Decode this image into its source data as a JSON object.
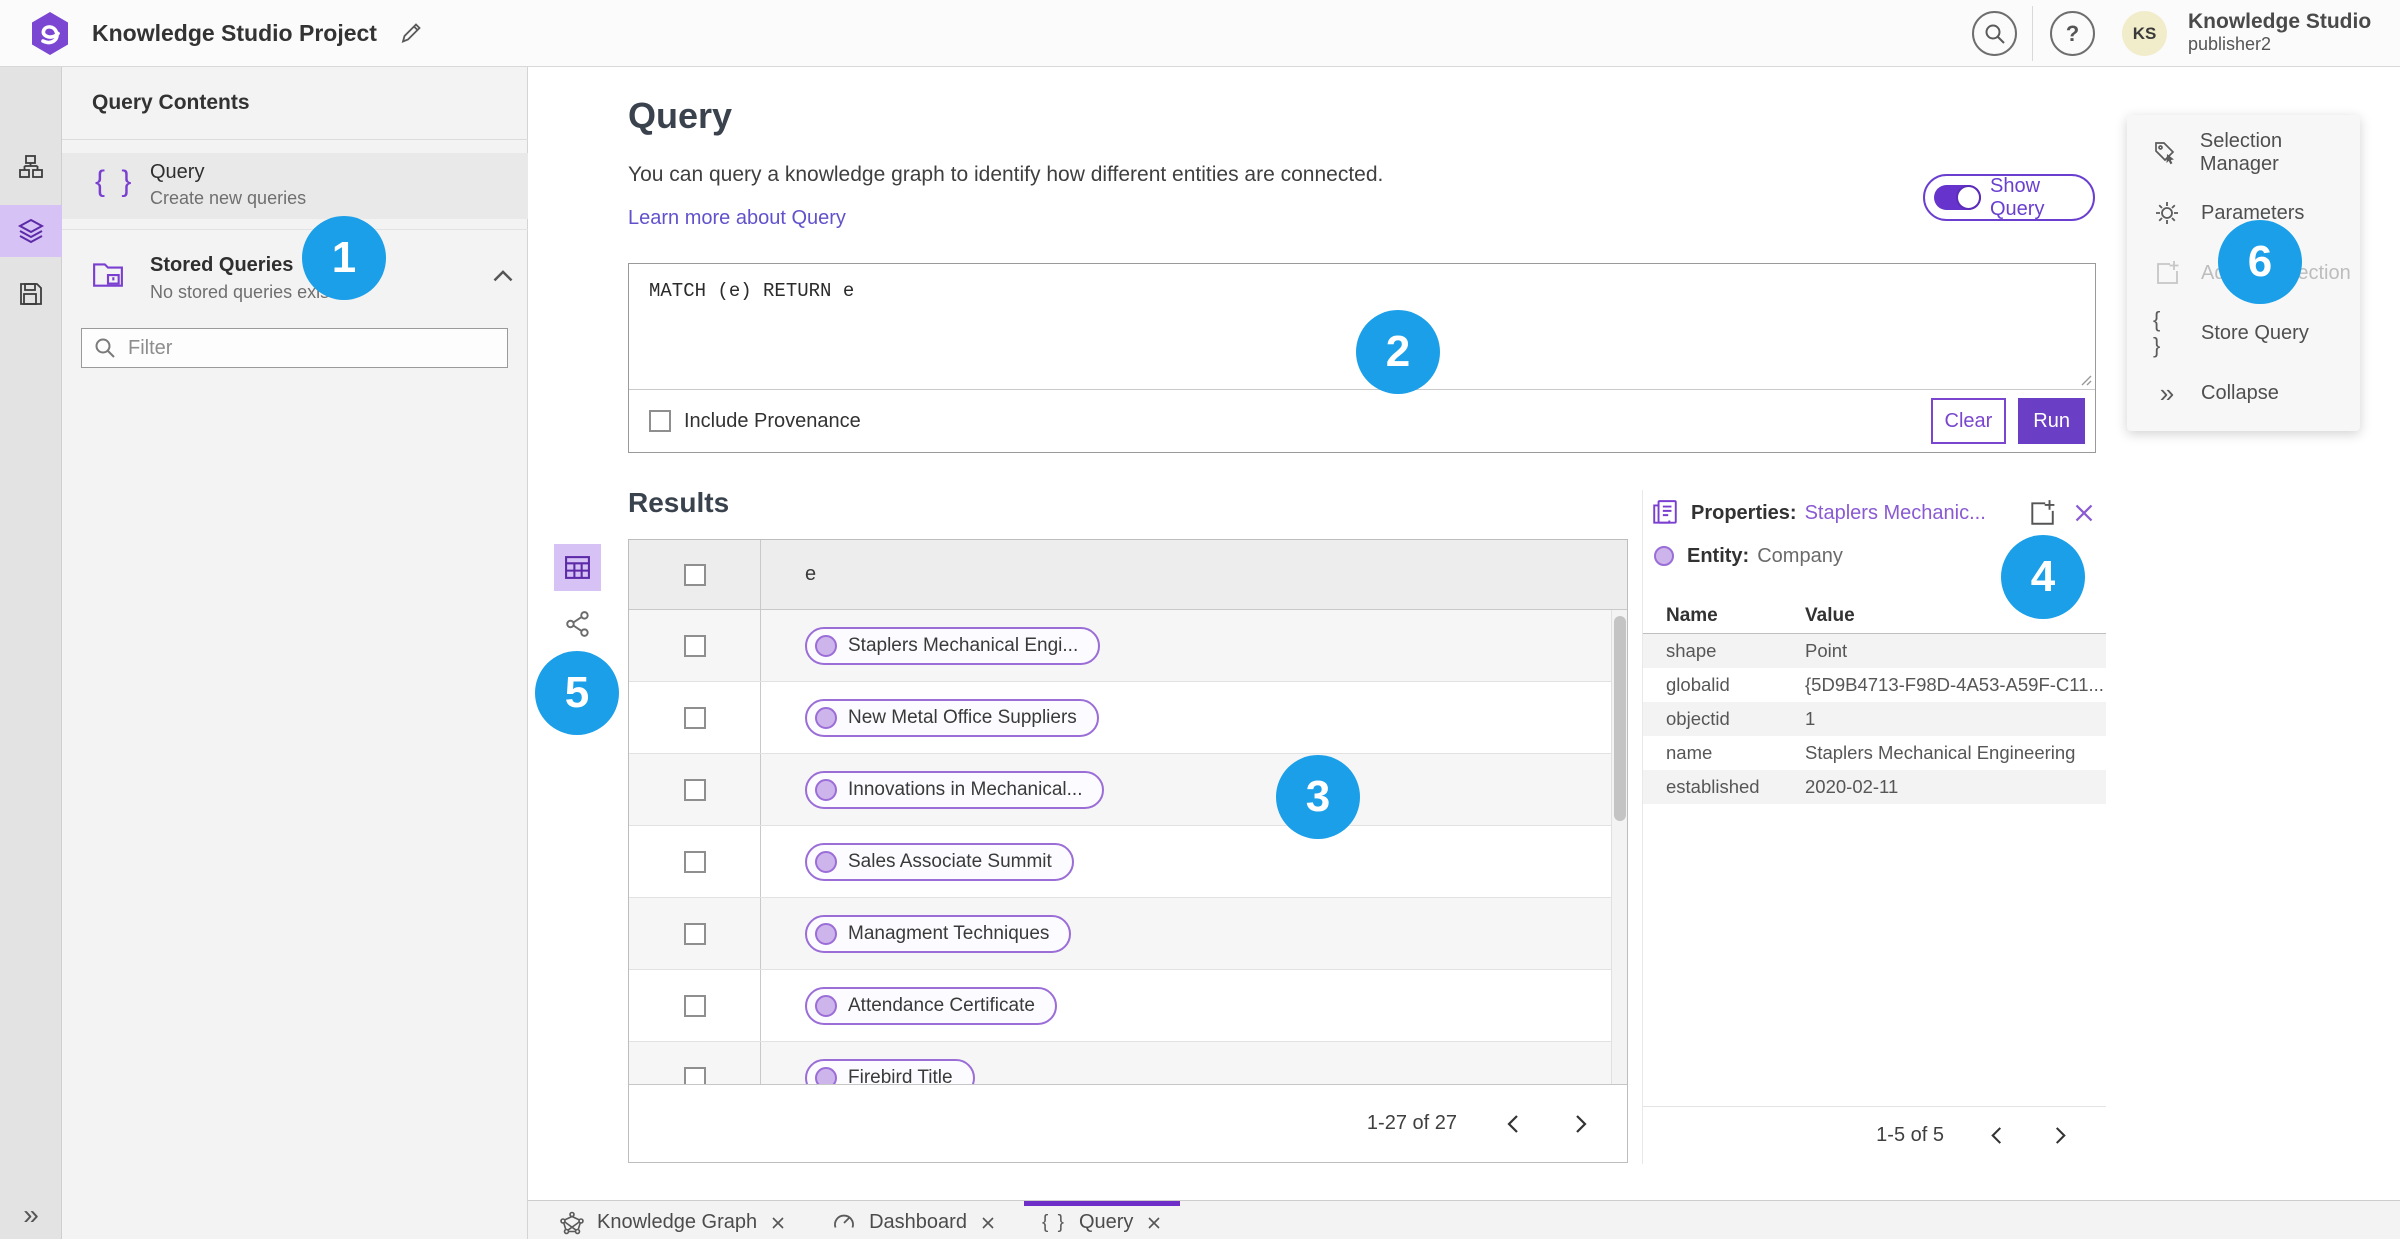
{
  "topbar": {
    "title": "Knowledge Studio Project",
    "user": {
      "initials": "KS",
      "name": "Knowledge Studio",
      "role": "publisher2"
    }
  },
  "glyphs": {
    "braces": "{ }",
    "collapse_chevrons": "»",
    "question_mark": "?"
  },
  "contents_panel": {
    "header": "Query Contents",
    "query_item": {
      "title": "Query",
      "subtitle": "Create new queries"
    },
    "stored_item": {
      "title": "Stored Queries",
      "subtitle": "No stored queries exist"
    },
    "filter_placeholder": "Filter"
  },
  "query_section": {
    "heading": "Query",
    "description": "You can query a knowledge graph to identify how different entities are connected.",
    "learn_more": "Learn more about Query",
    "show_query_label": "Show Query",
    "code": "MATCH (e) RETURN e",
    "include_provenance_label": "Include Provenance",
    "clear_label": "Clear",
    "run_label": "Run"
  },
  "results": {
    "heading": "Results",
    "column_header": "e",
    "rows": [
      {
        "label": "Staplers Mechanical Engi..."
      },
      {
        "label": "New Metal Office Suppliers"
      },
      {
        "label": "Innovations in Mechanical..."
      },
      {
        "label": "Sales Associate Summit"
      },
      {
        "label": "Managment Techniques"
      },
      {
        "label": "Attendance Certificate"
      },
      {
        "label": "Firebird Title"
      }
    ],
    "pagination": "1-27 of 27"
  },
  "properties": {
    "title": "Properties:",
    "entity_link": "Staplers Mechanic...",
    "entity_label": "Entity:",
    "entity_type": "Company",
    "col_name": "Name",
    "col_value": "Value",
    "rows": [
      {
        "name": "shape",
        "value": "Point"
      },
      {
        "name": "globalid",
        "value": "{5D9B4713-F98D-4A53-A59F-C11..."
      },
      {
        "name": "objectid",
        "value": "1"
      },
      {
        "name": "name",
        "value": "Staplers Mechanical Engineering"
      },
      {
        "name": "established",
        "value": "2020-02-11"
      }
    ],
    "pagination": "1-5 of 5"
  },
  "side_menu": {
    "items": [
      {
        "label": "Selection Manager"
      },
      {
        "label": "Parameters"
      },
      {
        "label": "Add To Selection"
      },
      {
        "label": "Store Query"
      },
      {
        "label": "Collapse"
      }
    ]
  },
  "tabs": [
    {
      "label": "Knowledge Graph"
    },
    {
      "label": "Dashboard"
    },
    {
      "label": "Query"
    }
  ],
  "annotations": [
    {
      "n": "1"
    },
    {
      "n": "2"
    },
    {
      "n": "3"
    },
    {
      "n": "4"
    },
    {
      "n": "5"
    },
    {
      "n": "6"
    }
  ],
  "colors": {
    "accent_purple": "#7a46cf",
    "run_button_purple": "#6b3ec6",
    "annotation_blue": "#1a9fe8",
    "link_purple": "#6152cc",
    "entity_fill": "#cdb5ec",
    "entity_border": "#9a6dd7"
  }
}
